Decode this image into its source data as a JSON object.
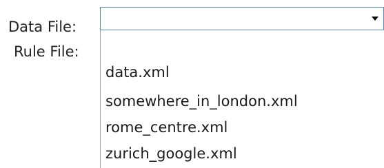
{
  "form": {
    "data_file_label": "Data File:",
    "rule_file_label": "Rule File:"
  },
  "data_file_combo": {
    "selected_value": "",
    "arrow_icon": "triangle-down-icon",
    "options": [
      "data.xml",
      "somewhere_in_london.xml",
      "rome_centre.xml",
      "zurich_google.xml"
    ]
  },
  "colors": {
    "combo_border": "#5a87c4",
    "dropdown_border": "#9aa3ad",
    "text": "#1a1a1a"
  }
}
